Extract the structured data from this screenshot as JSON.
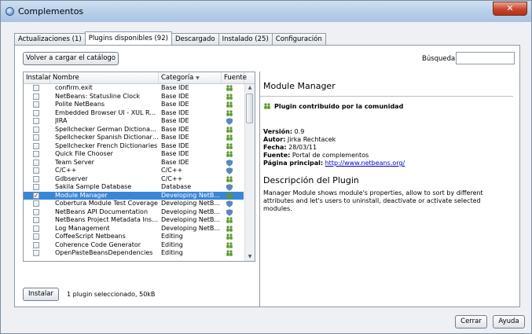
{
  "window": {
    "title": "Complementos",
    "close_glyph": "✕"
  },
  "tabs": [
    {
      "label": "Actualizaciones (1)",
      "active": false
    },
    {
      "label": "Plugins disponibles (92)",
      "active": true
    },
    {
      "label": "Descargado",
      "active": false
    },
    {
      "label": "Instalado (25)",
      "active": false
    },
    {
      "label": "Configuración",
      "active": false
    }
  ],
  "toolbar": {
    "reload_label": "Volver a cargar el catálogo",
    "search_label": "Búsqueda:",
    "search_value": ""
  },
  "table": {
    "headers": {
      "install": "Instalar",
      "name": "Nombre",
      "category": "Categoría",
      "sort_glyph": "▼",
      "source": "Fuente"
    },
    "rows": [
      {
        "name": "confirm.exit",
        "category": "Base IDE",
        "checked": false,
        "source": "community"
      },
      {
        "name": "NetBeans: Statusline Clock",
        "category": "Base IDE",
        "checked": false,
        "source": "community"
      },
      {
        "name": "Polite NetBeans",
        "category": "Base IDE",
        "checked": false,
        "source": "community"
      },
      {
        "name": "Embedded Browser UI - XUL Runner",
        "category": "Base IDE",
        "checked": false,
        "source": "community"
      },
      {
        "name": "JIRA",
        "category": "Base IDE",
        "checked": false,
        "source": "official"
      },
      {
        "name": "Spellchecker German Dictionaries",
        "category": "Base IDE",
        "checked": false,
        "source": "community"
      },
      {
        "name": "Spellchecker Spanish Dictionaries",
        "category": "Base IDE",
        "checked": false,
        "source": "community"
      },
      {
        "name": "Spellchecker French Dictionaries",
        "category": "Base IDE",
        "checked": false,
        "source": "community"
      },
      {
        "name": "Quick File Chooser",
        "category": "Base IDE",
        "checked": false,
        "source": "community"
      },
      {
        "name": "Team Server",
        "category": "Base IDE",
        "checked": false,
        "source": "official"
      },
      {
        "name": "C/C++",
        "category": "C/C++",
        "checked": false,
        "source": "official"
      },
      {
        "name": "Gdbserver",
        "category": "C/C++",
        "checked": false,
        "source": "community"
      },
      {
        "name": "Sakila Sample Database",
        "category": "Database",
        "checked": false,
        "source": "official"
      },
      {
        "name": "Module Manager",
        "category": "Developing NetB...",
        "checked": true,
        "selected": true,
        "source": "community"
      },
      {
        "name": "Cobertura Module Test Coverage",
        "category": "Developing NetB...",
        "checked": false,
        "source": "official"
      },
      {
        "name": "NetBeans API Documentation",
        "category": "Developing NetB...",
        "checked": false,
        "source": "official"
      },
      {
        "name": "NetBeans Project Metadata Inspe...",
        "category": "Developing NetB...",
        "checked": false,
        "source": "community"
      },
      {
        "name": "Log Management",
        "category": "Developing NetB...",
        "checked": false,
        "source": "community"
      },
      {
        "name": "CoffeeScript Netbeans",
        "category": "Editing",
        "checked": false,
        "source": "community"
      },
      {
        "name": "Coherence Code Generator",
        "category": "Editing",
        "checked": false,
        "source": "community"
      },
      {
        "name": "OpenPasteBeansDependencies",
        "category": "Editing",
        "checked": false,
        "source": "community"
      }
    ]
  },
  "detail": {
    "title": "Module Manager",
    "community_text": "Plugin contribuido por la comunidad",
    "version_label": "Versión:",
    "version_value": "0.9",
    "author_label": "Autor:",
    "author_value": "Jirka Rechtacek",
    "date_label": "Fecha:",
    "date_value": "28/03/11",
    "source_label": "Fuente:",
    "source_value": "Portal de complementos",
    "homepage_label": "Página principal:",
    "homepage_value": "http://www.netbeans.org/",
    "desc_title": "Descripción del Plugin",
    "desc_text": "Manager Module shows module's properties, allow to sort by different attributes and let's users to uninstall, deactivate or activate selected modules."
  },
  "footer": {
    "install_label": "Instalar",
    "status": "1 plugin seleccionado, 50kB",
    "close_label": "Cerrar",
    "help_label": "Ayuda"
  },
  "colors": {
    "community_icon": "#5d9a2f",
    "official_icon": "#5b88c4",
    "selection": "#3a86d6"
  }
}
